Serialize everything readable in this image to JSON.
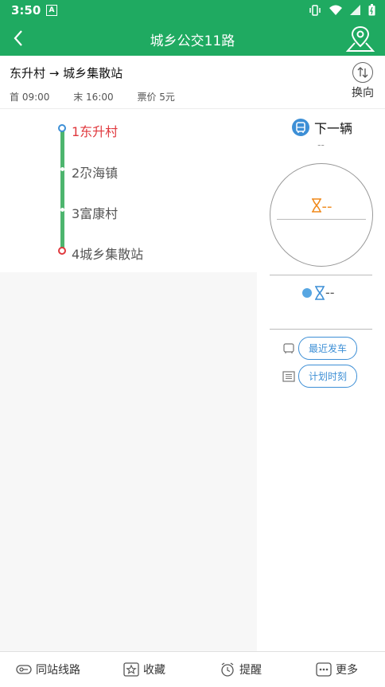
{
  "status": {
    "time": "3:50",
    "notif_icon": "A"
  },
  "appbar": {
    "title": "城乡公交11路"
  },
  "route": {
    "name": "东升村 → 城乡集散站",
    "first": "首 09:00",
    "last": "末 16:00",
    "fare": "票价 5元",
    "switch_label": "换向"
  },
  "stops": [
    {
      "label": "1东升村"
    },
    {
      "label": "2尕海镇"
    },
    {
      "label": "3富康村"
    },
    {
      "label": "4城乡集散站"
    }
  ],
  "next_bus": {
    "title": "下一辆",
    "dash": "--",
    "eta": "--",
    "second_eta": "--"
  },
  "actions": {
    "recent": "最近发车",
    "schedule": "计划时刻"
  },
  "nav": [
    {
      "label": "同站线路"
    },
    {
      "label": "收藏"
    },
    {
      "label": "提醒"
    },
    {
      "label": "更多"
    }
  ],
  "colors": {
    "brand": "#1faa61",
    "accent": "#3d8fd6",
    "active_stop": "#e0393e",
    "eta": "#f08a1c"
  }
}
